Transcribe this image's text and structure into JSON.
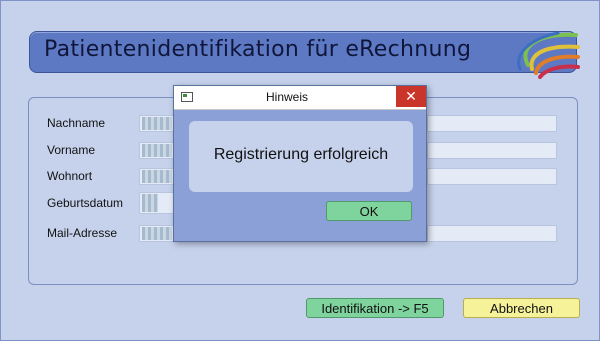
{
  "window": {
    "title": "Patientenidentifikation für eRechnung"
  },
  "form": {
    "fields": [
      {
        "label": "Nachname"
      },
      {
        "label": "Vorname"
      },
      {
        "label": "Wohnort"
      },
      {
        "label": "Geburtsdatum"
      },
      {
        "label": "Mail-Adresse"
      }
    ]
  },
  "buttons": {
    "identify_label": "Identifikation -> F5",
    "cancel_label": "Abbrechen"
  },
  "dialog": {
    "title": "Hinweis",
    "message": "Registrierung erfolgreich",
    "ok_label": "OK",
    "close_symbol": "✕"
  },
  "colors": {
    "window_bg": "#c6d2ec",
    "title_bar": "#5e79c4",
    "identify_button": "#7fd39d",
    "cancel_button": "#f6f29a",
    "close_button": "#c9352a"
  },
  "icons": [
    "logo-swoosh-icon",
    "window-icon",
    "close-icon"
  ]
}
